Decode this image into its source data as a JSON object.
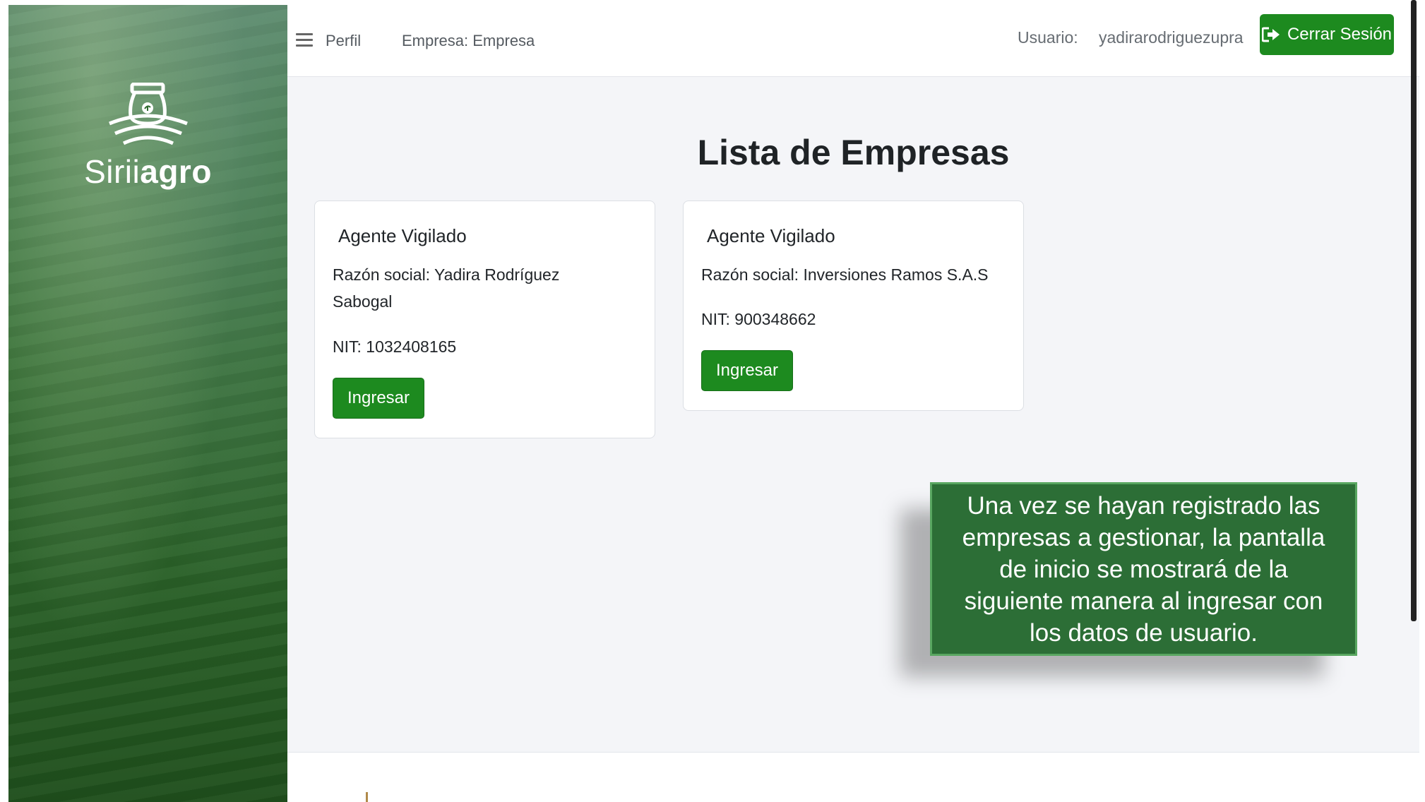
{
  "brand": {
    "name_light": "Sirii",
    "name_bold": "agro",
    "icon": "sack-with-leaf-logo"
  },
  "topbar": {
    "menu_icon": "hamburger-menu-icon",
    "nav": {
      "perfil": "Perfil",
      "empresa": "Empresa: Empresa"
    },
    "user_label": "Usuario:",
    "user_name": "yadirarodriguezupra",
    "logout_label": "Cerrar Sesión",
    "logout_icon": "sign-out-icon"
  },
  "main": {
    "title": "Lista de Empresas",
    "cards": [
      {
        "title": "Agente Vigilado",
        "razon_line1": "Razón social: Yadira Rodríguez",
        "razon_line2": "Sabogal",
        "nit": "NIT: 1032408165",
        "button": "Ingresar"
      },
      {
        "title": "Agente Vigilado",
        "razon_line1": "Razón social: Inversiones Ramos S.A.S",
        "nit": "NIT: 900348662",
        "button": "Ingresar"
      }
    ]
  },
  "callout": {
    "lines": [
      "Una vez se hayan registrado las",
      "empresas a gestionar, la pantalla",
      "de inicio se mostrará de la",
      "siguiente manera al ingresar con",
      "los datos de usuario."
    ]
  },
  "colors": {
    "accent_green": "#1d8a1f",
    "callout_bg": "#2c6e36",
    "page_bg": "#f4f5f8"
  }
}
